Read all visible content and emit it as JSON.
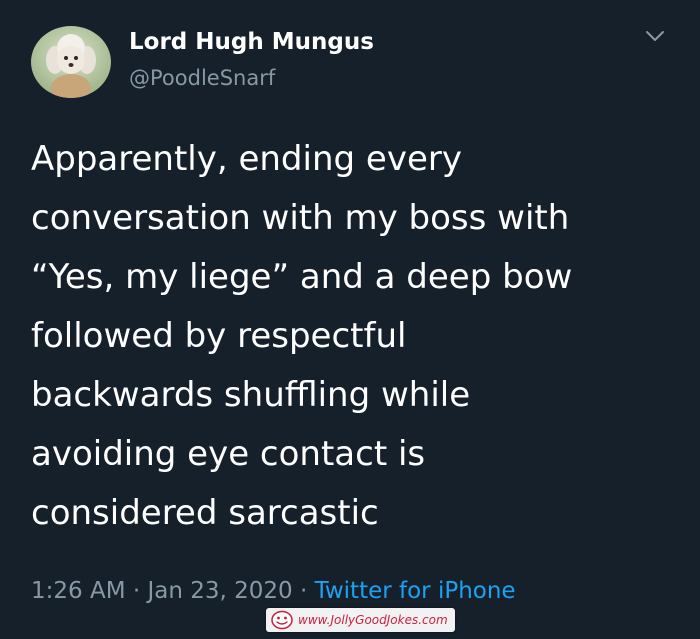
{
  "user": {
    "display_name": "Lord Hugh Mungus",
    "handle": "@PoodleSnarf",
    "avatar_icon": "poodle-avatar"
  },
  "tweet": {
    "text_lines": [
      "Apparently, ending every",
      "conversation with my boss with",
      "“Yes, my liege” and a deep bow",
      "followed by respectful",
      "backwards shuffling while",
      "avoiding eye contact is",
      "considered sarcastic"
    ]
  },
  "meta": {
    "time": "1:26 AM",
    "separator": "·",
    "date": "Jan 23, 2020",
    "source": "Twitter for iPhone"
  },
  "menu": {
    "icon": "chevron-down-icon"
  },
  "watermark": {
    "text": "www.JollyGoodJokes.com",
    "icon": "smiley-face-icon"
  },
  "colors": {
    "background": "#15202b",
    "primary_text": "#ffffff",
    "secondary_text": "#8899a6",
    "link": "#1da1f2",
    "watermark_text": "#cc1f3f"
  }
}
